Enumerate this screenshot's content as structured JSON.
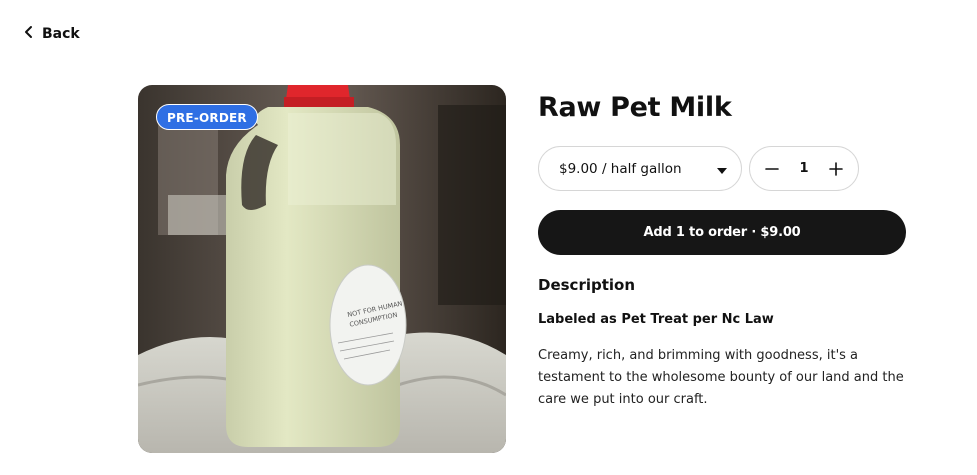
{
  "nav": {
    "back_label": "Back",
    "back_icon": "chevron-left-icon"
  },
  "product": {
    "badge": "PRE-ORDER",
    "title": "Raw Pet Milk",
    "label_text": [
      "NOT FOR HUMAN",
      "CONSUMPTION"
    ]
  },
  "variant": {
    "selected": "$9.00 / half gallon",
    "icon": "caret-down-icon"
  },
  "quantity": {
    "value": "1",
    "decrement_icon": "minus-icon",
    "increment_icon": "plus-icon"
  },
  "cta": {
    "label": "Add 1 to order · $9.00"
  },
  "description": {
    "heading": "Description",
    "subheading": "Labeled as Pet Treat per Nc Law",
    "body": "Creamy, rich, and brimming with goodness, it's a testament to the wholesome bounty of our land and the care we put into our craft."
  },
  "colors": {
    "badge": "#2f6fe4",
    "cta_bg": "#161616",
    "cap": "#e0262c",
    "milk": "#dfe4be"
  }
}
